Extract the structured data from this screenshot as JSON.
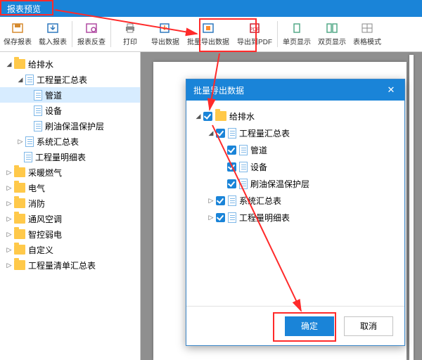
{
  "titleBar": {
    "title": "报表预览"
  },
  "toolbar": {
    "save": "保存报表",
    "load": "载入报表",
    "review": "报表反查",
    "print": "打印",
    "export": "导出数据",
    "batchExport": "批量导出数据",
    "exportPdf": "导出到PDF",
    "single": "单页显示",
    "double": "双页显示",
    "grid": "表格模式"
  },
  "sidebar": {
    "root0": "给排水",
    "root0_children": {
      "n0": "工程量汇总表",
      "n0_children": {
        "c0": "管道",
        "c1": "设备",
        "c2": "刷油保温保护层"
      },
      "n1": "系统汇总表",
      "n2": "工程量明细表"
    },
    "root1": "采暖燃气",
    "root2": "电气",
    "root3": "消防",
    "root4": "通风空调",
    "root5": "智控弱电",
    "root6": "自定义",
    "root7": "工程量清单汇总表"
  },
  "dialog": {
    "title": "批量导出数据",
    "close": "✕",
    "tree": {
      "r0": "给排水",
      "r0_n0": "工程量汇总表",
      "r0_n0_c0": "管道",
      "r0_n0_c1": "设备",
      "r0_n0_c2": "刷油保温保护层",
      "r0_n1": "系统汇总表",
      "r0_n2": "工程量明细表"
    },
    "ok": "确定",
    "cancel": "取消"
  }
}
